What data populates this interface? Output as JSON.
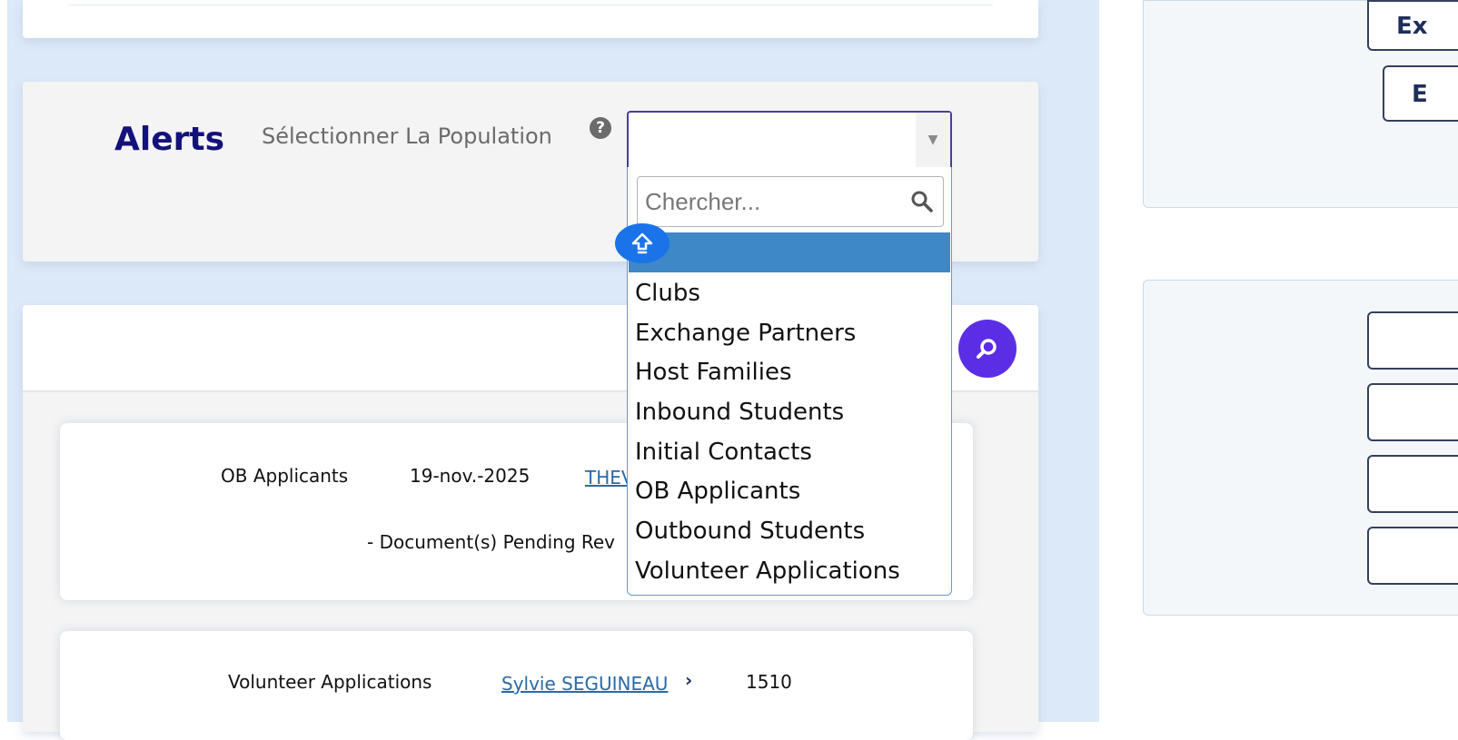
{
  "alerts": {
    "title": "Alerts",
    "population_label": "Sélectionner La Population",
    "select_value": ""
  },
  "dropdown": {
    "search_placeholder": "Chercher...",
    "options": [
      "Clubs",
      "Exchange Partners",
      "Host Families",
      "Inbound Students",
      "Initial Contacts",
      "OB Applicants",
      "Outbound Students",
      "Volunteer Applications"
    ]
  },
  "alert_items": [
    {
      "population": "OB Applicants",
      "date": "19-nov.-2025",
      "name_link": "THEV",
      "description": "- Document(s) Pending Rev"
    },
    {
      "population": "Volunteer Applications",
      "name_link": "Sylvie SEGUINEAU",
      "link_chevron": "›",
      "number": "1510"
    }
  ],
  "right_panel": {
    "export_button_partial": "Ex",
    "second_button_partial": "E"
  },
  "colors": {
    "alerts_title": "#14127a",
    "search_fab": "#5b2ee6",
    "dropdown_highlight": "#3f88c8",
    "link": "#2b6aa6"
  }
}
